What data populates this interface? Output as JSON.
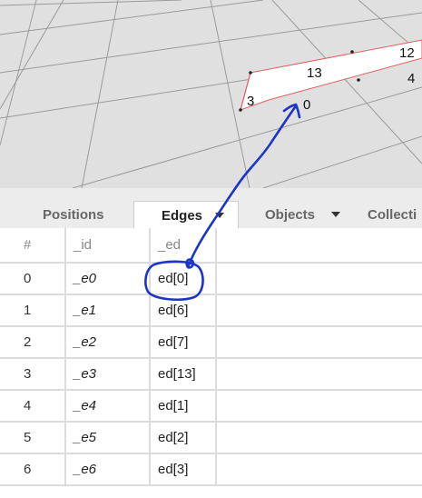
{
  "viewport": {
    "vertex_labels": {
      "v13": "13",
      "v12": "12",
      "v3": "3",
      "v0": "0",
      "v4": "4"
    }
  },
  "tabs": [
    {
      "label": "Positions",
      "active": false
    },
    {
      "label": "Edges",
      "active": true,
      "has_dropdown": true
    },
    {
      "label": "Objects",
      "active": false,
      "has_dropdown": true
    },
    {
      "label": "Collecti",
      "active": false
    }
  ],
  "table": {
    "headers": [
      "#",
      "_id",
      "_ed"
    ],
    "rows": [
      {
        "num": "0",
        "id": "_e0",
        "ed": "ed[0]"
      },
      {
        "num": "1",
        "id": "_e1",
        "ed": "ed[6]"
      },
      {
        "num": "2",
        "id": "_e2",
        "ed": "ed[7]"
      },
      {
        "num": "3",
        "id": "_e3",
        "ed": "ed[13]"
      },
      {
        "num": "4",
        "id": "_e4",
        "ed": "ed[1]"
      },
      {
        "num": "5",
        "id": "_e5",
        "ed": "ed[2]"
      },
      {
        "num": "6",
        "id": "_e6",
        "ed": "ed[3]"
      }
    ]
  },
  "colors": {
    "viewport_bg": "#e0e0e0",
    "grid_line": "#9a9a9a",
    "face_fill": "#ffffff",
    "face_edge": "#e06060",
    "annotation": "#1a35c8"
  }
}
